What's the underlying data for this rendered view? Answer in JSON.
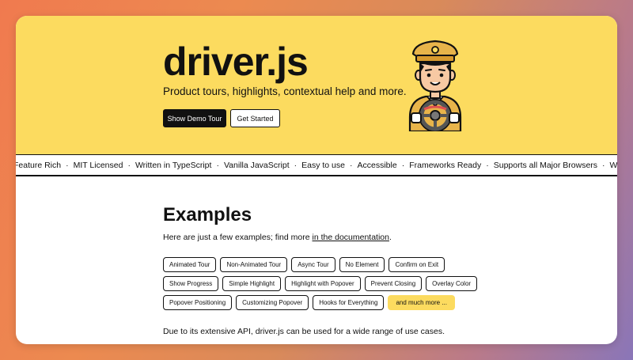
{
  "hero": {
    "title": "driver.js",
    "subtitle": "Product tours, highlights, contextual help and more.",
    "demo_button": "Show Demo Tour",
    "started_button": "Get Started",
    "colors": {
      "hero_bg": "#fcdb5f",
      "primary_btn": "#111111"
    }
  },
  "marquee": {
    "items": [
      "Feature Rich",
      "MIT Licensed",
      "Written in TypeScript",
      "Vanilla JavaScript",
      "Easy to use",
      "Accessible",
      "Frameworks Ready",
      "Supports all Major Browsers",
      "Works on Mobile Devices"
    ],
    "separator": "·"
  },
  "examples": {
    "title": "Examples",
    "intro_prefix": "Here are just a few examples; find more ",
    "intro_link": "in the documentation",
    "intro_suffix": ".",
    "rows": [
      [
        "Animated Tour",
        "Non-Animated Tour",
        "Async Tour",
        "No Element",
        "Confirm on Exit"
      ],
      [
        "Show Progress",
        "Simple Highlight",
        "Highlight with Popover",
        "Prevent Closing",
        "Overlay Color"
      ],
      [
        "Popover Positioning",
        "Customizing Popover",
        "Hooks for Everything"
      ]
    ],
    "more_label": "and much more ...",
    "use_cases": "Due to its extensive API, driver.js can be used for a wide range of use cases."
  }
}
